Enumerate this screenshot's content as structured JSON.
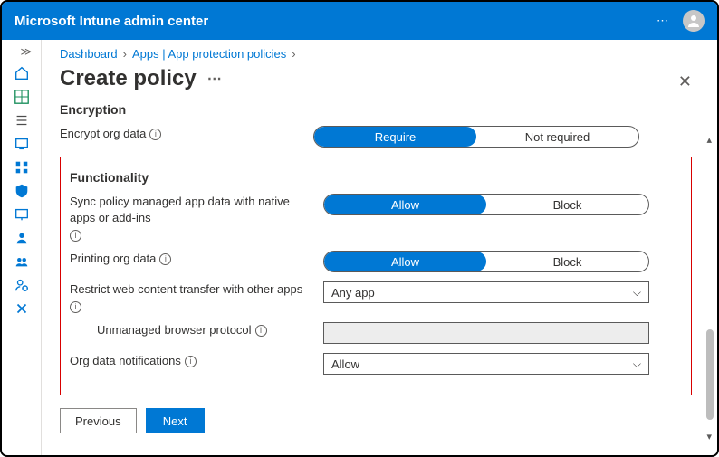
{
  "titlebar": {
    "title": "Microsoft Intune admin center",
    "more": "⋯"
  },
  "breadcrumb": {
    "a": "Dashboard",
    "b": "Apps | App protection policies"
  },
  "page": {
    "title": "Create policy"
  },
  "sections": {
    "encryption": "Encryption",
    "functionality": "Functionality"
  },
  "rows": {
    "encrypt": {
      "label": "Encrypt org data",
      "opt1": "Require",
      "opt2": "Not required"
    },
    "sync": {
      "label": "Sync policy managed app data with native apps or add-ins",
      "opt1": "Allow",
      "opt2": "Block"
    },
    "printing": {
      "label": "Printing org data",
      "opt1": "Allow",
      "opt2": "Block"
    },
    "restrict": {
      "label": "Restrict web content transfer with other apps",
      "value": "Any app"
    },
    "unm": {
      "label": "Unmanaged browser protocol",
      "value": ""
    },
    "notif": {
      "label": "Org data notifications",
      "value": "Allow"
    }
  },
  "buttons": {
    "prev": "Previous",
    "next": "Next"
  }
}
